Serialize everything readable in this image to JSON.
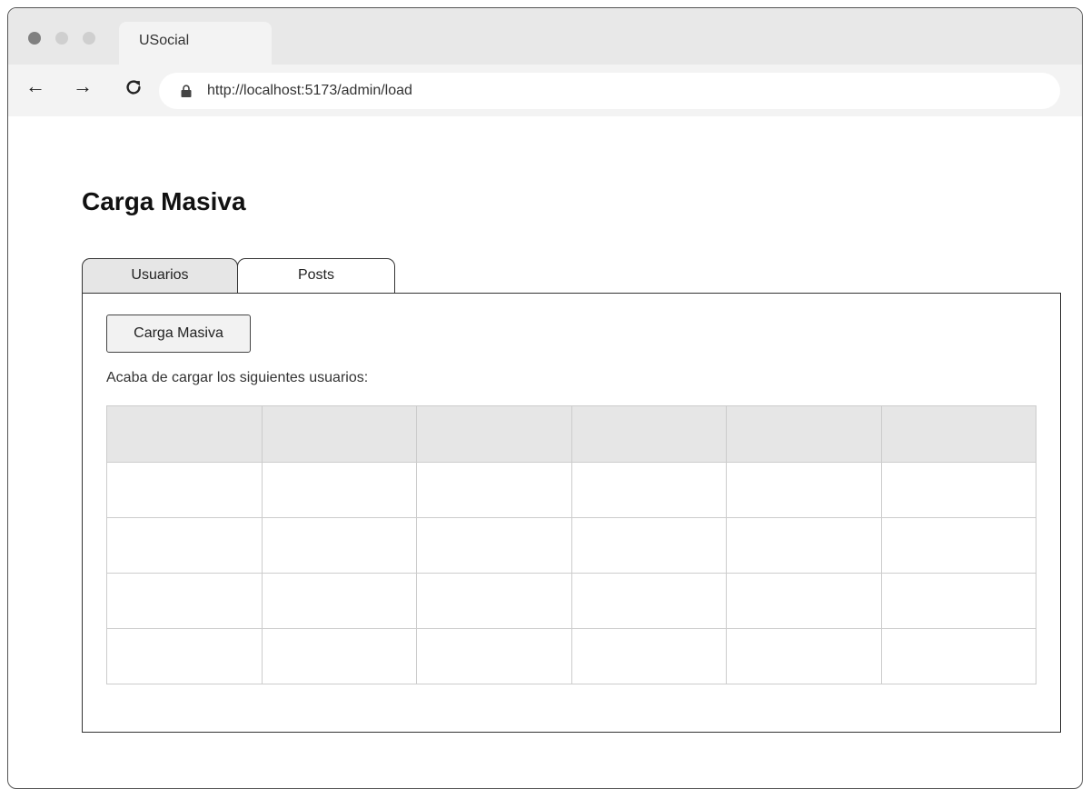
{
  "browser": {
    "tab_title": "USocial",
    "url": "http://localhost:5173/admin/load"
  },
  "page": {
    "title": "Carga Masiva"
  },
  "tabs": [
    {
      "label": "Usuarios",
      "active": false
    },
    {
      "label": "Posts",
      "active": true
    }
  ],
  "panel": {
    "load_button_label": "Carga Masiva",
    "message": "Acaba de cargar los siguientes usuarios:"
  },
  "table": {
    "headers": [
      "",
      "",
      "",
      "",
      "",
      ""
    ],
    "rows": [
      [
        "",
        "",
        "",
        "",
        "",
        ""
      ],
      [
        "",
        "",
        "",
        "",
        "",
        ""
      ],
      [
        "",
        "",
        "",
        "",
        "",
        ""
      ],
      [
        "",
        "",
        "",
        "",
        "",
        ""
      ]
    ]
  },
  "icons": {
    "back": "arrow-left-icon",
    "forward": "arrow-right-icon",
    "reload": "reload-icon",
    "lock": "lock-icon"
  },
  "colors": {
    "tab_inactive": "#e6e6e6",
    "table_header": "#e6e6e6",
    "border": "#333333"
  }
}
